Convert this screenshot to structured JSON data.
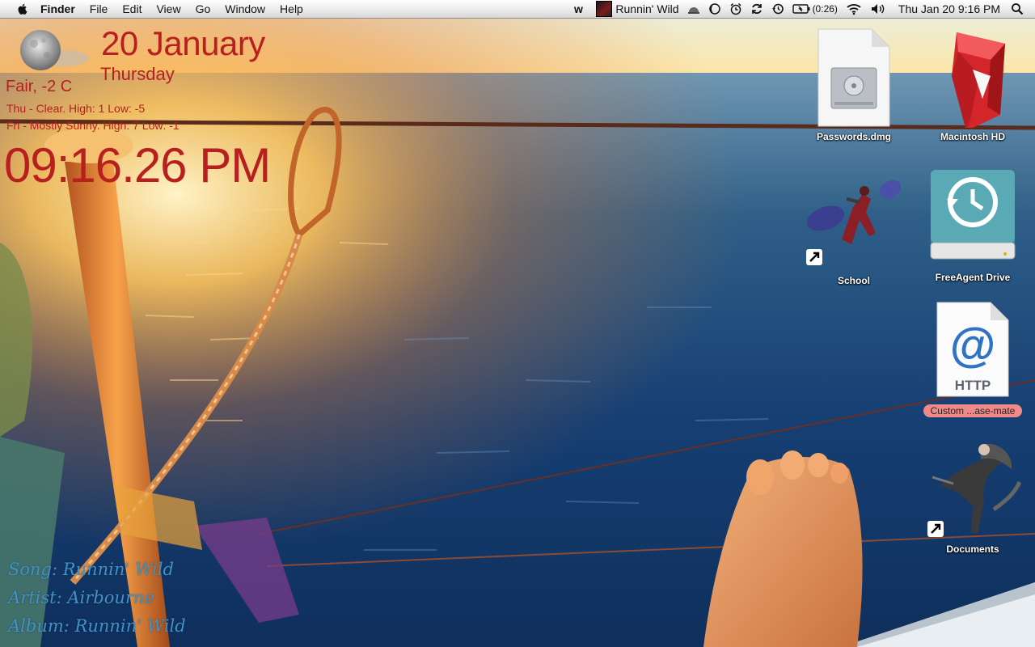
{
  "menubar": {
    "app_name": "Finder",
    "menus": [
      "File",
      "Edit",
      "View",
      "Go",
      "Window",
      "Help"
    ],
    "now_playing": "Runnin' Wild",
    "battery_time": "(0:26)",
    "clock": "Thu Jan 20  9:16 PM",
    "icons": [
      "apple-logo-icon",
      "wunderlist-icon",
      "album-art-thumbnail",
      "dome-icon",
      "moon-phase-icon",
      "alarm-clock-icon",
      "sync-icon",
      "time-machine-icon",
      "battery-icon",
      "wifi-icon",
      "volume-icon",
      "spotlight-icon"
    ]
  },
  "widgets": {
    "date": "20 January",
    "day": "Thursday",
    "condition": "Fair, -2 C",
    "forecast": [
      "Thu - Clear. High: 1 Low: -5",
      "Fri - Mostly Sunny. High: 7 Low: -1"
    ],
    "time": "09:16.26 PM",
    "weather_icon": "moon-cloud-icon",
    "accent_color": "#b8201f"
  },
  "now_playing_widget": {
    "song": "Song: Runnin' Wild",
    "artist": "Artist: Airbourne",
    "album": "Album: Runnin' Wild",
    "color": "#3f93c9"
  },
  "desktop_icons": [
    {
      "label": "Passwords.dmg",
      "icon": "disk-image-icon"
    },
    {
      "label": "Macintosh HD",
      "icon": "hard-drive-icon"
    },
    {
      "label": "School",
      "icon": "alias-character-icon"
    },
    {
      "label": "FreeAgent Drive",
      "icon": "time-machine-drive-icon"
    },
    {
      "label": "Custom ...ase-mate",
      "icon": "http-location-icon",
      "label_color": "#f08a8a"
    },
    {
      "label": "Documents",
      "icon": "alias-character-icon"
    }
  ]
}
